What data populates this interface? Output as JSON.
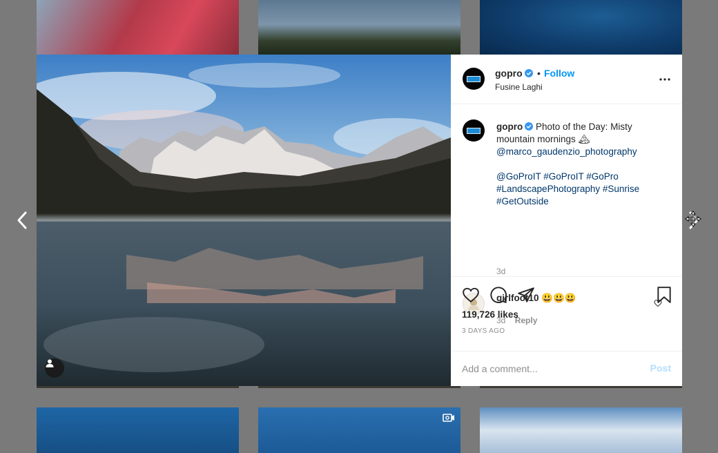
{
  "post": {
    "username": "gopro",
    "follow_label": "Follow",
    "dot": "•",
    "location": "Fusine Laghi",
    "caption_text": "Photo of the Day: Misty mountain mornings 🏔",
    "caption_mention": "@marco_gaudenzio_photography",
    "caption_tags": "@GoProIT #GoProIT #GoPro #LandscapePhotography #Sunrise #GetOutside",
    "caption_time": "3d",
    "comment": {
      "username": "girlfoot10",
      "text": "😃😃😃",
      "time": "3d",
      "reply_label": "Reply"
    },
    "likes": "119,726 likes",
    "date": "3 DAYS AGO",
    "add_comment_placeholder": "Add a comment...",
    "post_label": "Post"
  },
  "icons": {
    "more": "more-options-icon",
    "verified": "verified-badge-icon",
    "like": "heart-icon",
    "comment": "comment-icon",
    "share": "share-icon",
    "save": "bookmark-icon",
    "prev": "chevron-left-icon",
    "next": "chevron-right-icon",
    "user_tag": "user-tag-icon",
    "video": "video-icon"
  },
  "colors": {
    "accent": "#0095f6",
    "verified": "#3897f0",
    "link": "#00376b",
    "muted": "#8e8e8e",
    "overlay": "#7a7a7a"
  }
}
